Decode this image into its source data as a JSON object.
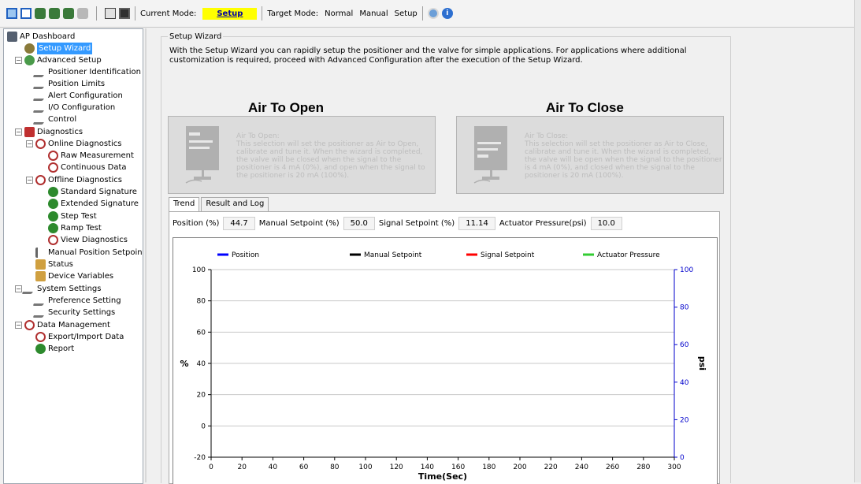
{
  "toolbar": {
    "icons": [
      "layout-icon",
      "window-icon",
      "connect-icon",
      "disconnect-icon",
      "user-icon",
      "refresh-icon",
      "print-icon",
      "save-icon"
    ],
    "current_mode_label": "Current Mode:",
    "current_mode_value": "Setup",
    "target_mode_label": "Target Mode:",
    "target_modes": [
      "Normal",
      "Manual",
      "Setup"
    ],
    "help_icons": [
      "help-icon",
      "info-icon"
    ]
  },
  "tree": {
    "items": [
      {
        "label": "AP Dashboard",
        "icon": "dashboard-icon"
      },
      {
        "label": "Setup Wizard",
        "icon": "wizard-icon"
      },
      {
        "label": "Advanced Setup",
        "icon": "advanced-setup-icon"
      },
      {
        "label": "Positioner Identification",
        "icon": "pencil-icon"
      },
      {
        "label": "Position Limits",
        "icon": "pencil-icon"
      },
      {
        "label": "Alert Configuration",
        "icon": "pencil-icon"
      },
      {
        "label": "I/O Configuration",
        "icon": "pencil-icon"
      },
      {
        "label": "Control",
        "icon": "pencil-icon"
      },
      {
        "label": "Diagnostics",
        "icon": "diagnostics-icon"
      },
      {
        "label": "Online Diagnostics",
        "icon": "gauge-icon"
      },
      {
        "label": "Raw Measurement",
        "icon": "gauge-icon"
      },
      {
        "label": "Continuous Data",
        "icon": "gauge-icon"
      },
      {
        "label": "Offline Diagnostics",
        "icon": "gauge-icon"
      },
      {
        "label": "Standard Signature",
        "icon": "green-gauge-icon"
      },
      {
        "label": "Extended Signature",
        "icon": "green-gauge-icon"
      },
      {
        "label": "Step Test",
        "icon": "green-gauge-icon"
      },
      {
        "label": "Ramp Test",
        "icon": "green-gauge-icon"
      },
      {
        "label": "View Diagnostics",
        "icon": "gauge-icon"
      },
      {
        "label": "Manual Position Setpoint",
        "icon": "setpoint-icon"
      },
      {
        "label": "Status",
        "icon": "status-icon"
      },
      {
        "label": "Device Variables",
        "icon": "status-icon"
      },
      {
        "label": "System Settings",
        "icon": "pencil-icon"
      },
      {
        "label": "Preference Setting",
        "icon": "pencil-icon"
      },
      {
        "label": "Security Settings",
        "icon": "pencil-icon"
      },
      {
        "label": "Data Management",
        "icon": "gauge-icon"
      },
      {
        "label": "Export/Import Data",
        "icon": "gauge-icon"
      },
      {
        "label": "Report",
        "icon": "green-gauge-icon"
      }
    ]
  },
  "wizard": {
    "group_title": "Setup Wizard",
    "description": "With the Setup Wizard you can rapidly setup the positioner and the valve for simple applications. For applications where additional customization is required, proceed with Advanced Configuration after the execution of the Setup Wizard.",
    "ato_title": "Air To Open",
    "atc_title": "Air To Close",
    "ato_text_title": "Air To Open:",
    "ato_text": "This selection will set the positioner as Air to Open, calibrate and tune it. When the wizard is completed, the valve will be closed when the signal to the positioner is 4 mA (0%), and open when the signal to the positioner is 20 mA (100%).",
    "atc_text_title": "Air To Close:",
    "atc_text": "This selection will set the positioner as Air to Close, calibrate and tune it. When the wizard is completed, the valve will be open when the signal to the positioner is 4 mA (0%), and closed when the signal to the positioner is 20 mA (100%)."
  },
  "tabs": [
    "Trend",
    "Result and Log"
  ],
  "readouts": {
    "position_label": "Position (%)",
    "position_value": "44.7",
    "manual_label": "Manual Setpoint (%)",
    "manual_value": "50.0",
    "signal_label": "Signal Setpoint (%)",
    "signal_value": "11.14",
    "pressure_label": "Actuator Pressure(psi)",
    "pressure_value": "10.0"
  },
  "colors": {
    "position": "#0000ff",
    "manual": "#000000",
    "signal": "#ff0000",
    "pressure": "#33cc33",
    "right_axis": "#0000cc",
    "highlight": "#ffff00"
  },
  "chart_data": {
    "type": "line",
    "series": [
      {
        "name": "Position",
        "values": []
      },
      {
        "name": "Manual Setpoint",
        "values": []
      },
      {
        "name": "Signal Setpoint",
        "values": []
      },
      {
        "name": "Actuator Pressure",
        "values": []
      }
    ],
    "xlabel": "Time(Sec)",
    "ylabel": "%",
    "y2label": "psi",
    "xlim": [
      0,
      300
    ],
    "ylim": [
      -20,
      100
    ],
    "y2lim": [
      0,
      100
    ],
    "x_ticks": [
      0,
      20,
      40,
      60,
      80,
      100,
      120,
      140,
      160,
      180,
      200,
      220,
      240,
      260,
      280,
      300
    ],
    "y_ticks": [
      -20,
      0,
      20,
      40,
      60,
      80,
      100
    ],
    "y2_ticks": [
      0,
      20,
      40,
      60,
      80,
      100
    ],
    "grid": true,
    "legend_position": "top"
  }
}
